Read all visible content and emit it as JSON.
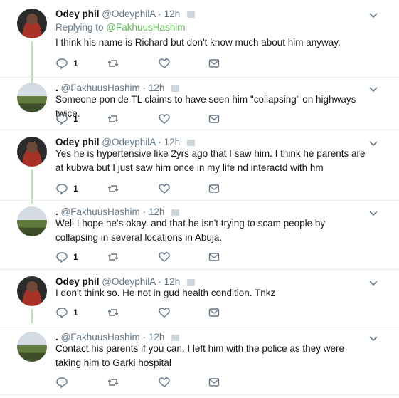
{
  "tweets": [
    {
      "name": "Odey phil",
      "handle": "@OdeyphilA",
      "time": "12h",
      "replying_prefix": "Replying to ",
      "replying_to": "@FakhuusHashim",
      "text": "I think his name is Richard but don't know much about him anyway.",
      "reply_count": "1",
      "avatar": "odey"
    },
    {
      "name": ".",
      "handle": "@FakhuusHashim",
      "time": "12h",
      "text": "Someone pon de TL claims to have seen him \"collapsing\" on highways twice.",
      "reply_count": "1",
      "avatar": "fak"
    },
    {
      "name": "Odey phil",
      "handle": "@OdeyphilA",
      "time": "12h",
      "text": "Yes he is hypertensive like 2yrs ago that I saw him. I think he parents are at kubwa but I just saw him once in my life nd interactd with hm",
      "reply_count": "1",
      "avatar": "odey"
    },
    {
      "name": ".",
      "handle": "@FakhuusHashim",
      "time": "12h",
      "text": "Well I hope he's okay, and that he isn't trying to scam people by collapsing in several locations in Abuja.",
      "reply_count": "1",
      "avatar": "fak"
    },
    {
      "name": "Odey phil",
      "handle": "@OdeyphilA",
      "time": "12h",
      "text": "I don't think so. He not in gud health condition. Tnkz",
      "reply_count": "1",
      "avatar": "odey"
    },
    {
      "name": ".",
      "handle": "@FakhuusHashim",
      "time": "12h",
      "text": "Contact his parents if you can. I left him with the police as they were taking him to Garki hospital",
      "reply_count": "",
      "avatar": "fak"
    }
  ],
  "header_separator": "·",
  "icons": {
    "reply": "reply-icon",
    "retweet": "retweet-icon",
    "like": "like-icon",
    "dm": "direct-message-icon",
    "more": "chevron-down-icon"
  },
  "colors": {
    "mention": "#64b85a",
    "rail": "#b7e0a5",
    "secondary": "#657786",
    "icon": "#657786"
  }
}
